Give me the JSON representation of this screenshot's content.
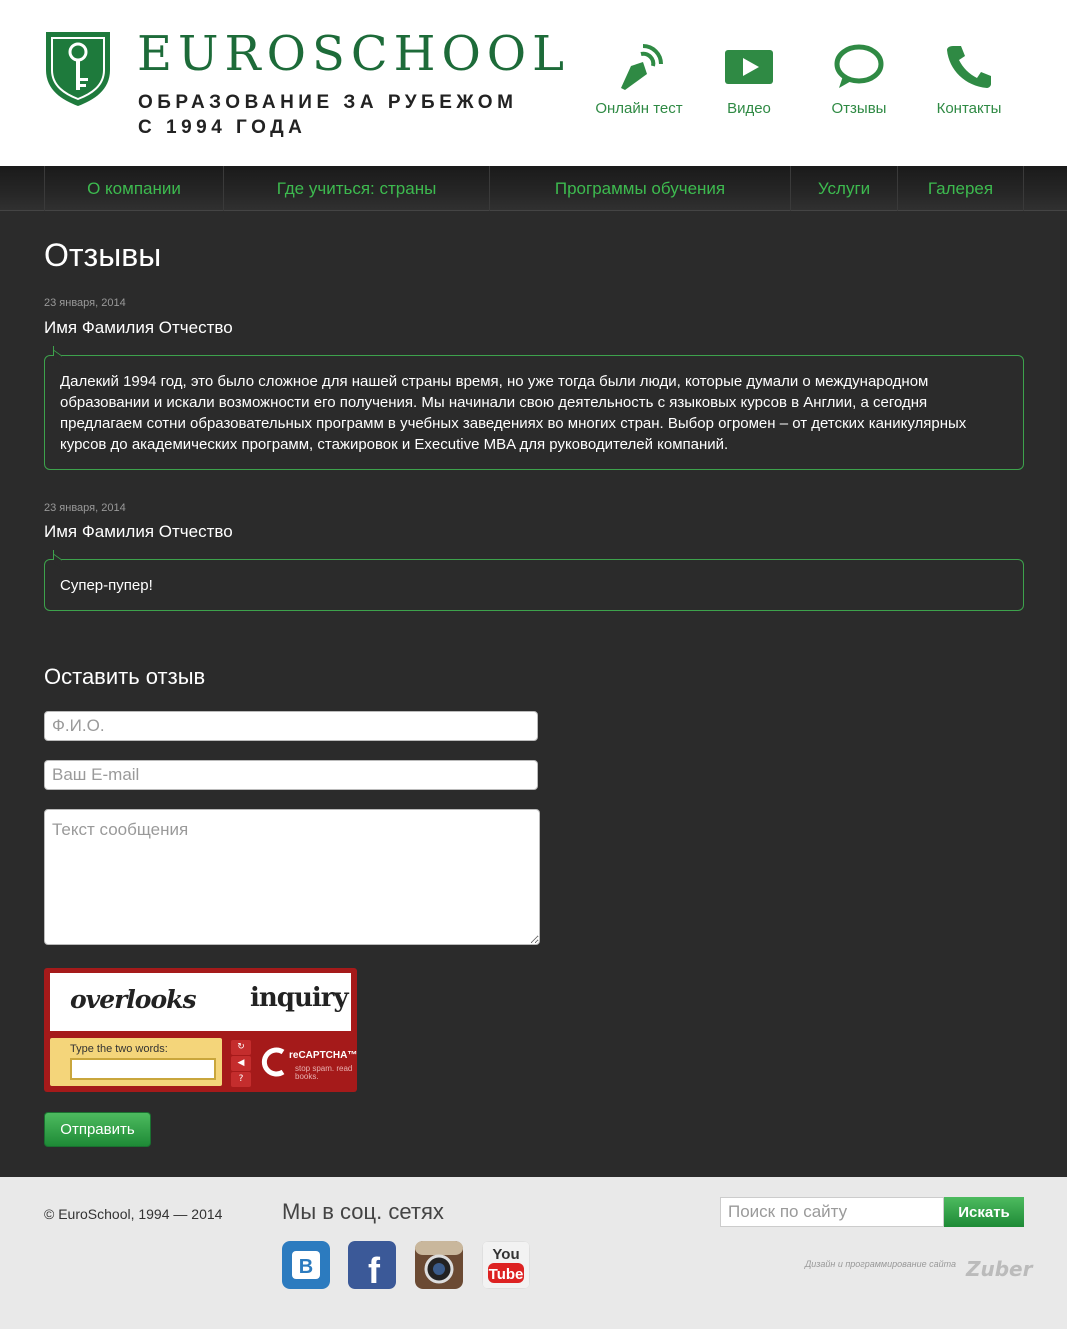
{
  "header": {
    "logo_title": "EUROSCHOOL",
    "logo_subtitle": "ОБРАЗОВАНИЕ ЗА РУБЕЖОМ С 1994 ГОДА",
    "quick_links": [
      {
        "label": "Онлайн тест",
        "icon": "pen-signal-icon"
      },
      {
        "label": "Видео",
        "icon": "video-play-icon"
      },
      {
        "label": "Отзывы",
        "icon": "speech-bubble-icon"
      },
      {
        "label": "Контакты",
        "icon": "phone-icon"
      }
    ],
    "accent_color": "#2f8a44"
  },
  "nav": {
    "items": [
      {
        "label": "О компании"
      },
      {
        "label": "Где учиться: страны"
      },
      {
        "label": "Программы обучения"
      },
      {
        "label": "Услуги"
      },
      {
        "label": "Галерея"
      }
    ],
    "link_color": "#3dba4f"
  },
  "main": {
    "title": "Отзывы",
    "reviews": [
      {
        "date": "23 января, 2014",
        "author": "Имя Фамилия Отчество",
        "text": "Далекий 1994 год, это было сложное для нашей страны время, но уже тогда были люди, которые думали о международном образовании и искали возможности его получения. Мы начинали свою деятельность с языковых курсов в Англии, а сегодня предлагаем сотни образовательных программ в учебных заведениях во многих стран. Выбор огромен – от детских каникулярных курсов до академических программ, стажировок и Executive MBA для руководителей компаний."
      },
      {
        "date": "23 января, 2014",
        "author": "Имя Фамилия Отчество",
        "text": "Супер-пупер!"
      }
    ],
    "form": {
      "title": "Оставить отзыв",
      "name_placeholder": "Ф.И.О.",
      "email_placeholder": "Ваш E-mail",
      "message_placeholder": "Текст сообщения",
      "captcha": {
        "word1": "overlooks",
        "word2": "inquiry",
        "prompt": "Type the two words:",
        "brand": "reCAPTCHA™",
        "tagline": "stop spam. read books."
      },
      "submit_label": "Отправить"
    }
  },
  "footer": {
    "copyright": "© EuroSchool, 1994 — 2014",
    "social_title": "Мы в соц. сетях",
    "social": [
      {
        "name": "vkontakte-icon"
      },
      {
        "name": "facebook-icon"
      },
      {
        "name": "instagram-icon"
      },
      {
        "name": "youtube-icon"
      }
    ],
    "search_placeholder": "Поиск по сайту",
    "search_button": "Искать",
    "credit_text": "Дизайн и программирование сайта",
    "credit_logo": "Zuber"
  }
}
